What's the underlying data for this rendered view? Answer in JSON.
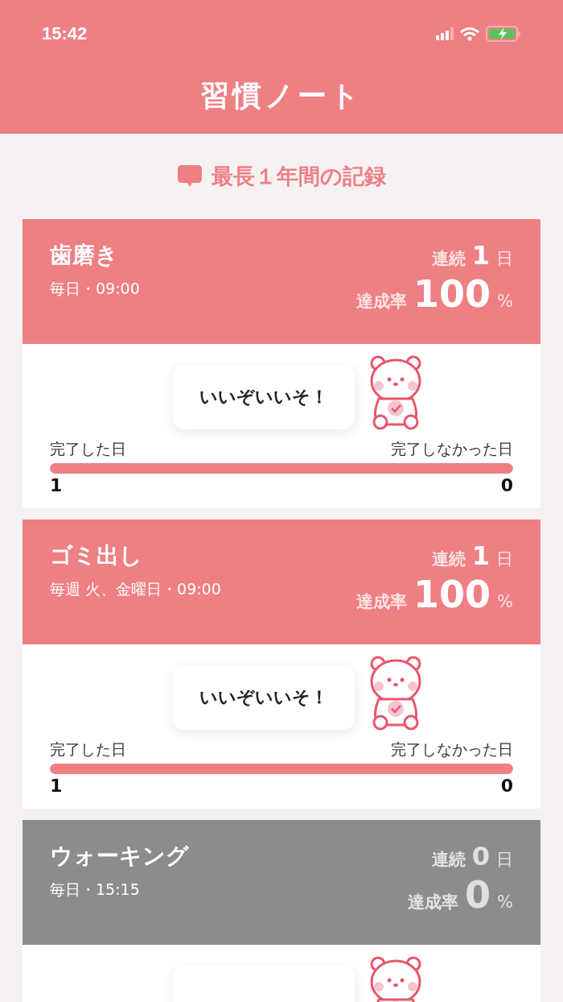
{
  "status_bar": {
    "time": "15:42"
  },
  "header": {
    "title": "習慣ノート"
  },
  "subtitle": "最長１年間の記録",
  "habits": [
    {
      "title": "歯磨き",
      "schedule": "毎日・09:00",
      "streak_label": "連続",
      "streak": "1",
      "streak_unit": "日",
      "rate_label": "達成率",
      "rate": "100",
      "rate_unit": "%",
      "active": true,
      "message": "いいぞいいそ！",
      "done_label": "完了した日",
      "missed_label": "完了しなかった日",
      "level": 1,
      "done_count": "1",
      "missed_count": "0"
    },
    {
      "title": "ゴミ出し",
      "schedule": "毎週 火、金曜日・09:00",
      "streak_label": "連続",
      "streak": "1",
      "streak_unit": "日",
      "rate_label": "達成率",
      "rate": "100",
      "rate_unit": "%",
      "active": true,
      "message": "いいぞいいそ！",
      "done_label": "完了した日",
      "missed_label": "完了しなかった日",
      "level": 1,
      "done_count": "1",
      "missed_count": "0"
    },
    {
      "title": "ウォーキング",
      "schedule": "毎日・15:15",
      "streak_label": "連続",
      "streak": "0",
      "streak_unit": "日",
      "rate_label": "達成率",
      "rate": "0",
      "rate_unit": "%",
      "active": false
    }
  ]
}
